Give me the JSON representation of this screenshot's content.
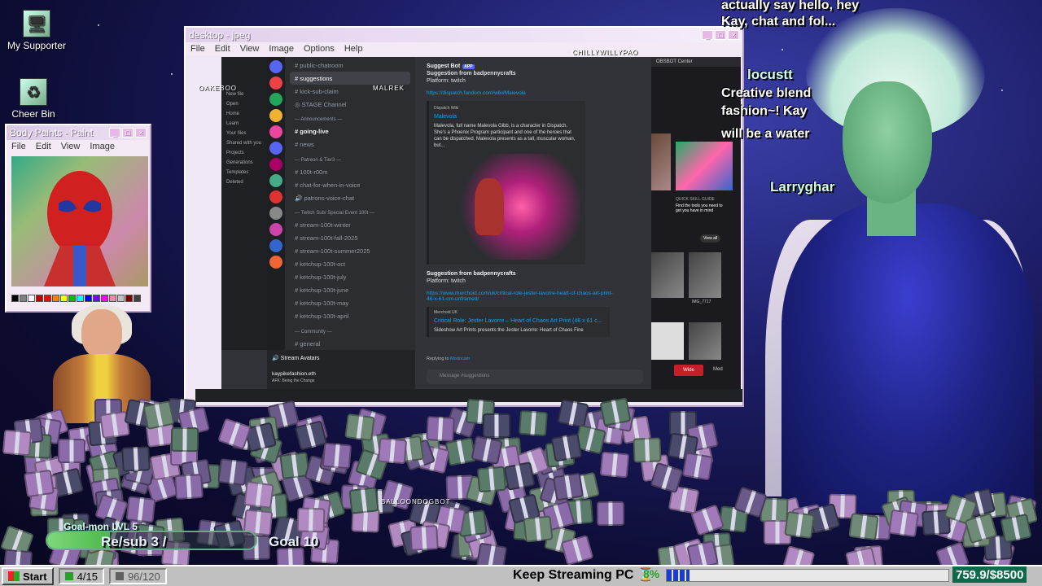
{
  "desktop": {
    "icons": [
      {
        "label": "My Supporter",
        "icon": "computer-icon"
      },
      {
        "label": "Cheer Bin",
        "icon": "recycle-bin-icon"
      }
    ]
  },
  "paint_window": {
    "title": "Body Paints - Paint",
    "menu": [
      "File",
      "Edit",
      "View",
      "Image"
    ],
    "palette": [
      "#000000",
      "#808080",
      "#ffffff",
      "#c00000",
      "#ff0000",
      "#ff8000",
      "#ffff00",
      "#00c000",
      "#00ffff",
      "#0000ff",
      "#8000ff",
      "#ff00ff",
      "#ff80c0",
      "#c0c0c0",
      "#800000",
      "#404040"
    ]
  },
  "desktop_window": {
    "title": "desktop - jpeg",
    "menu": [
      "File",
      "Edit",
      "View",
      "Image",
      "Options",
      "Help"
    ],
    "controls": [
      "_",
      "□",
      "×"
    ]
  },
  "stream_overlay": {
    "chat_lines": [
      {
        "user": "",
        "text": "actually say hello, hey"
      },
      {
        "user": "",
        "text": "Kay, chat and fol..."
      },
      {
        "user": "locustt",
        "text": ""
      },
      {
        "user": "",
        "text": "Creative blend"
      },
      {
        "user": "",
        "text": "fashion~! Kay"
      },
      {
        "user": "",
        "text": "will be a water"
      },
      {
        "user": "Larryghar",
        "text": ""
      }
    ],
    "tags": {
      "oakeboo": "OAKEBOO",
      "malrek": "MALREK",
      "chillywillypao": "CHILLYWILLYPAO",
      "balloondogbot": "BALLOONDOGBOT"
    }
  },
  "discord": {
    "files_sidebar": {
      "items": [
        "New file",
        "Open",
        "Home",
        "Learn",
        "Your files",
        "Shared with you",
        "Projects",
        "Generations",
        "Templates",
        "Deleted"
      ]
    },
    "channels": [
      {
        "name": "public-chatroom",
        "type": "text"
      },
      {
        "name": "suggestions",
        "type": "text",
        "active": true
      },
      {
        "name": "kick-sub-claim",
        "type": "text"
      },
      {
        "name": "STAGE Channel",
        "type": "stage"
      },
      {
        "name": "— Announcements —",
        "type": "category"
      },
      {
        "name": "going-live",
        "type": "text",
        "bold": true
      },
      {
        "name": "news",
        "type": "text"
      },
      {
        "name": "— Patreon & Tier3 —",
        "type": "category"
      },
      {
        "name": "100t-r00m",
        "type": "text"
      },
      {
        "name": "chat-for-when-in-voice",
        "type": "text"
      },
      {
        "name": "patrons-voice-chat",
        "type": "voice"
      },
      {
        "name": "— Twitch Sub/ Special Event 100t —",
        "type": "category"
      },
      {
        "name": "stream-100t-winter",
        "type": "text"
      },
      {
        "name": "stream-100t-fall-2025",
        "type": "text"
      },
      {
        "name": "stream-100t-summer2025",
        "type": "text"
      },
      {
        "name": "ketchup-100t-oct",
        "type": "text"
      },
      {
        "name": "ketchup-100t-july",
        "type": "text"
      },
      {
        "name": "ketchup-100t-june",
        "type": "text"
      },
      {
        "name": "ketchup-100t-may",
        "type": "text"
      },
      {
        "name": "ketchup-100t-april",
        "type": "text"
      },
      {
        "name": "— Community —",
        "type": "category"
      },
      {
        "name": "general",
        "type": "text"
      }
    ],
    "voice_channel": "Stream Avatars",
    "user": {
      "name": "kaypikefashion.eth",
      "status": "AFK: Being the Change"
    },
    "messages": [
      {
        "author": "Suggest Bot",
        "badge": "APP",
        "title": "Suggestion from badpennycrafts",
        "platform": "Platform: twitch",
        "link": "https://dispatch.fandom.com/wiki/Malevola",
        "embed": {
          "provider": "Dispatch Wiki",
          "title": "Malevola",
          "description": "Malevola, full name Malevola Gibb, is a character in Dispatch. She's a Phoenix Program participant and one of the heroes that can be dispatched. Malevola presents as a tall, muscular woman, but..."
        }
      },
      {
        "author": "",
        "title": "Suggestion from badpennycrafts",
        "platform": "Platform: twitch",
        "link": "https://www.merchoid.com/uk/critical-role-jester-lavorre-heart-of-chaos-art-print-46-x-61-cm-unframed/",
        "embed": {
          "provider": "Merchoid UK",
          "title": "Critical Role: Jester Lavorre – Heart of Chaos Art Print (46 x 61 c...",
          "description": "Sideshow Art Prints presents the Jester Lavorre: Heart of Chaos Fine"
        }
      }
    ],
    "replying_to": "Replying to",
    "replying_user": "Modocam",
    "composer_placeholder": "Message #suggestions"
  },
  "obsbot": {
    "title": "OBSBOT Center",
    "guide_title": "QUICK SKILL GUIDE",
    "guide_text": "Find the tools you need to get you have in mind",
    "view_all": "View all",
    "file_label": "IMG_7717",
    "wide_button": "Wide",
    "media_button": "Med"
  },
  "goal": {
    "title": "Goal-mon LVL 5",
    "progress_text": "Re/sub 3 /",
    "goal_text": "Goal 10",
    "fraction": 0.3
  },
  "taskbar": {
    "start_label": "Start",
    "counter1": "4/15",
    "counter2": "96/120",
    "keep_streaming": "Keep Streaming PC",
    "percent": "8%",
    "progress_fraction": 0.08,
    "money": "759.9/$8500"
  },
  "colors": {
    "discord_bg": "#313338",
    "accent_link": "#00a8fc",
    "goal_fill": "#7fd87a",
    "progress_blue": "#1a3bd8",
    "money_bg": "#0a6a4a"
  }
}
